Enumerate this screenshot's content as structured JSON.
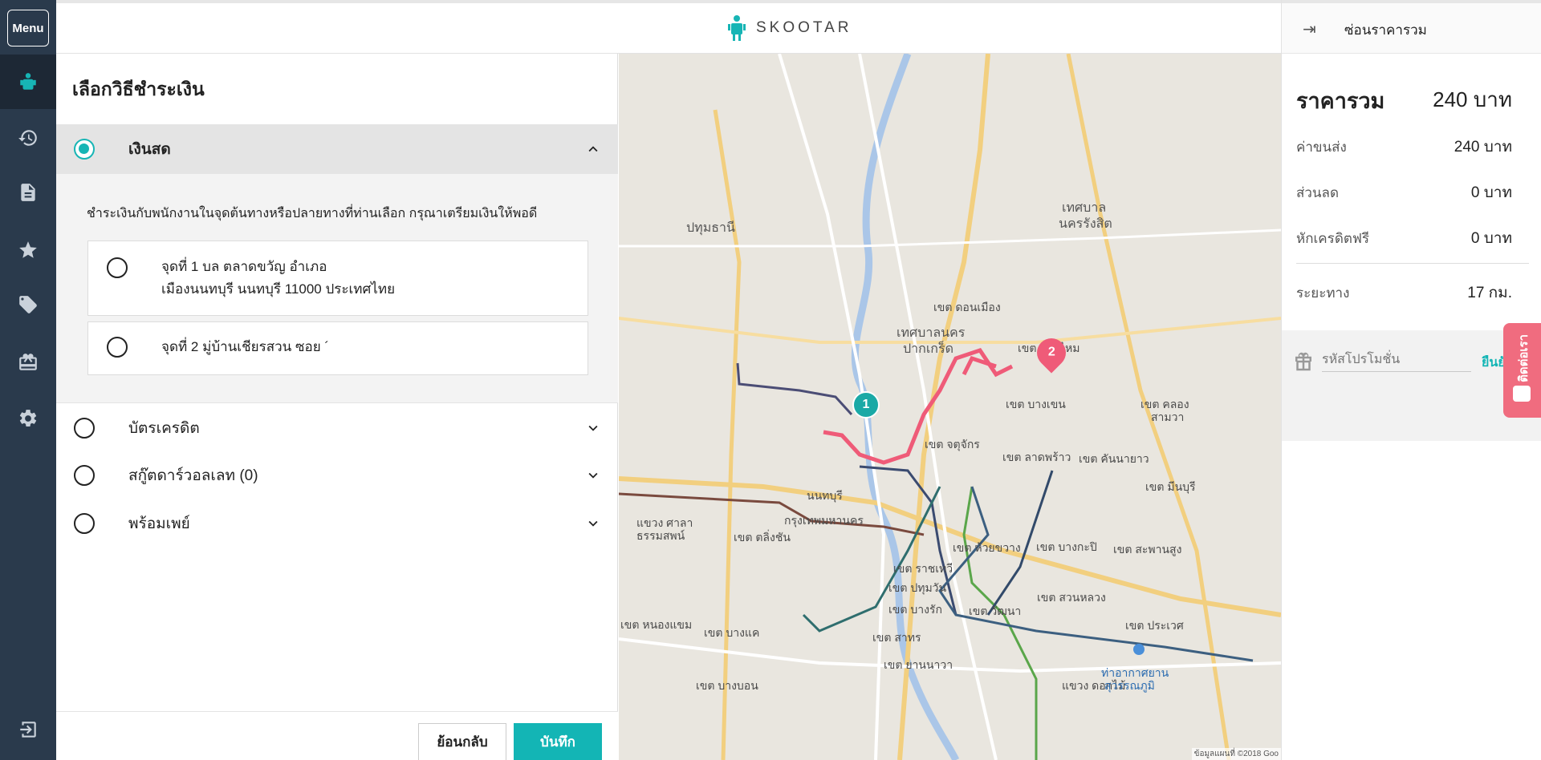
{
  "sidebar": {
    "menu_label": "Menu",
    "icons": [
      "skootar-logo-icon",
      "history-icon",
      "document-icon",
      "star-icon",
      "tag-icon",
      "gift-icon",
      "gear-icon",
      "logout-icon"
    ]
  },
  "topbar": {
    "brand": "SKOOTAR"
  },
  "payment": {
    "title": "เลือกวิธีชำระเงิน",
    "cash": {
      "label": "เงินสด",
      "description": "ชำระเงินกับพนักงานในจุดต้นทางหรือปลายทางที่ท่านเลือก กรุณาเตรียมเงินให้พอดี",
      "point1_line1": "จุดที่ 1                                  บล ตลาดขวัญ อำเภอ",
      "point1_line2": "เมืองนนทบุรี นนทบุรี 11000 ประเทศไทย",
      "point2": "จุดที่ 2                  มู่บ้านเชียรสวน ซอย ´"
    },
    "credit_card": "บัตรเครดิต",
    "wallet": "สกู๊ตดาร์วอลเลท (0)",
    "promptpay": "พร้อมเพย์",
    "back_button": "ย้อนกลับ",
    "save_button": "บันทึก"
  },
  "map": {
    "labels": {
      "pathum_thani": "ปทุมธานี",
      "thesaban_rangsit": "เทศบาล",
      "thesaban_rangsit2": "นครรังสิต",
      "don_mueang": "เขต ดอนเมือง",
      "pak_kret1": "เทศบาลนคร",
      "pak_kret2": "ปากเกร็ด",
      "sai_mai": "เขต สายไหม",
      "bang_khen": "เขต บางเขน",
      "chatuchak": "เขต จตุจักร",
      "lat_phrao": "เขต ลาดพร้าว",
      "khan_na_yao": "เขต คันนายาว",
      "khlong_sam_wa1": "เขต คลอง",
      "khlong_sam_wa2": "สามวา",
      "min_buri": "เขต มีนบุรี",
      "nonthaburi": "นนทบุรี",
      "bangkok": "กรุงเทพมหานคร",
      "taling_chan": "เขต ตลิ่งชัน",
      "huai_khwang": "เขต ห้วยขวาง",
      "bang_kapi": "เขต บางกะปิ",
      "saphan_sung": "เขต สะพานสูง",
      "ratchathewi": "เขต ราชเทวี",
      "pathum_wan": "เขต ปทุมวัน",
      "suan_luang": "เขต สวนหลวง",
      "bang_rak": "เขต บางรัก",
      "watthana": "เขต วัฒนา",
      "prawet": "เขต ประเวศ",
      "bang_khae": "เขต บางแค",
      "sathon": "เขต สาทร",
      "nong_khaem": "เขต หนองแขม",
      "yan_nawa": "เขต ยานนาวา",
      "bang_phli": "แขวง ดอกไม้",
      "bang_bon": "เขต บางบอน",
      "airport1": "ท่าอากาศยาน",
      "airport2": "สุวรรณภูมิ",
      "sala_thammasop1": "แขวง ศาลา",
      "sala_thammasop2": "ธรรมสพน์",
      "copyright": "ข้อมูลแผนที่ ©2018 Goo"
    },
    "pins": [
      "1",
      "2"
    ]
  },
  "summary": {
    "hide_label": "ซ่อนราคารวม",
    "total_label": "ราคารวม",
    "total_value": "240 บาท",
    "rows": [
      {
        "label": "ค่าขนส่ง",
        "value": "240  บาท"
      },
      {
        "label": "ส่วนลด",
        "value": "0  บาท"
      },
      {
        "label": "หักเครดิตฟรี",
        "value": "0  บาท"
      },
      {
        "label": "ระยะทาง",
        "value": "17  กม."
      }
    ],
    "promo_placeholder": "รหัสโปรโมชั่น",
    "promo_apply": "ยืนยัน",
    "contact_tab": "ติดต่อเรา"
  }
}
